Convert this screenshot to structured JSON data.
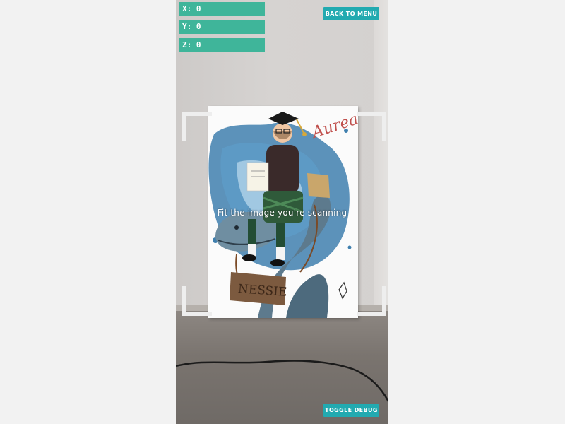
{
  "debug": {
    "x_label": "X: 0",
    "y_label": "Y: 0",
    "z_label": "Z: 0",
    "toggle_label": "TOGGLE DEBUG"
  },
  "navigation": {
    "back_label": "BACK TO MENU"
  },
  "scanner": {
    "hint": "Fit the image you're scanning"
  },
  "poster": {
    "sign_text": "NESSIE",
    "signature": "Aurea"
  },
  "colors": {
    "debug_box": "#3fb59a",
    "button": "#22aab0",
    "frame_corner": "#eeeeee"
  }
}
